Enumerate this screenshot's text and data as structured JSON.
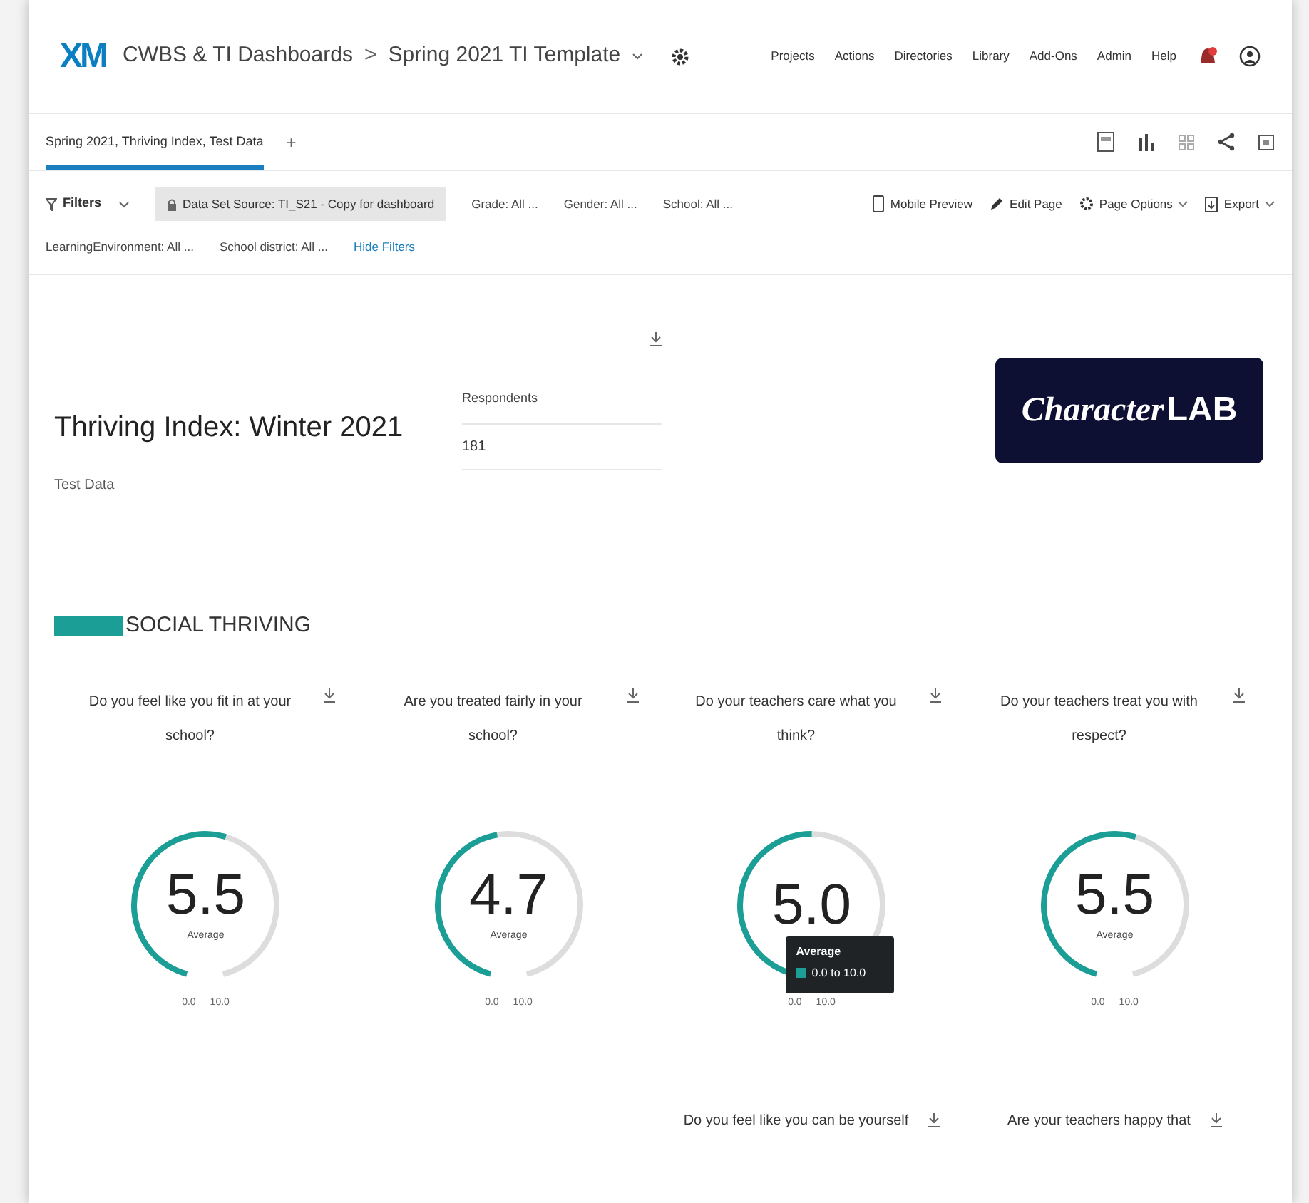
{
  "header": {
    "logo": "XM",
    "breadcrumb": [
      "CWBS & TI Dashboards",
      "Spring 2021 TI Template"
    ],
    "separator": ">",
    "nav": [
      "Projects",
      "Actions",
      "Directories",
      "Library",
      "Add-Ons",
      "Admin",
      "Help"
    ]
  },
  "tabs": [
    {
      "label": "Spring 2021, Thriving Index, Test Data",
      "selected": true
    }
  ],
  "add_tab": "+",
  "filters": {
    "label": "Filters",
    "chips": [
      {
        "label": "Data Set Source: TI_S21 - Copy for dashboard",
        "kind": "locked"
      },
      {
        "label": "Grade: All ...",
        "kind": "plain"
      },
      {
        "label": "Gender: All ...",
        "kind": "plain"
      },
      {
        "label": "School: All ...",
        "kind": "plain"
      },
      {
        "label": "LearningEnvironment: All ...",
        "kind": "plain"
      },
      {
        "label": "School district: All ...",
        "kind": "plain"
      }
    ],
    "hide": "Hide Filters"
  },
  "actions": [
    {
      "label": "Mobile Preview",
      "kind": "phone"
    },
    {
      "label": "Edit Page",
      "kind": "pencil"
    },
    {
      "label": "Page Options",
      "kind": "gear"
    },
    {
      "label": "Export",
      "kind": "export"
    }
  ],
  "title": "Thriving Index: Winter 2021",
  "subtitle": "Test Data",
  "respondents": {
    "label": "Respondents",
    "value": "181"
  },
  "brand": {
    "italic": "Character",
    "bold": "LAB"
  },
  "section": "SOCIAL THRIVING",
  "gauges": [
    {
      "question": "Do you feel like you fit in at your school?",
      "value": "5.5",
      "level": 0.55,
      "caption": "Average",
      "min": "0.0",
      "max": "10.0"
    },
    {
      "question": "Are you treated fairly in your school?",
      "value": "4.7",
      "level": 0.47,
      "caption": "Average",
      "min": "0.0",
      "max": "10.0"
    },
    {
      "question": "Do your teachers care what you think?",
      "value": "5.0",
      "level": 0.5,
      "min": "0.0",
      "max": "10.0",
      "tooltip": {
        "title": "Average",
        "item": "0.0 to 10.0",
        "color": "#1a9e96"
      }
    },
    {
      "question": "Do your teachers treat you with respect?",
      "value": "5.5",
      "level": 0.55,
      "caption": "Average",
      "min": "0.0",
      "max": "10.0"
    }
  ],
  "next_questions": [
    "Do you feel like you can be yourself",
    "Are your teachers happy that"
  ]
}
